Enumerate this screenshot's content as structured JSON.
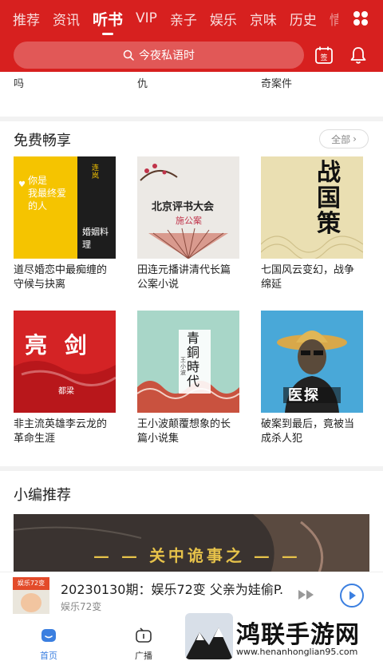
{
  "header": {
    "tabs": [
      "推荐",
      "资讯",
      "听书",
      "VIP",
      "亲子",
      "娱乐",
      "京味",
      "历史",
      "情"
    ],
    "active_tab": "听书",
    "search_placeholder": "今夜私语时",
    "calendar_label": "签"
  },
  "top_strip": {
    "items": [
      "吗",
      "仇",
      "奇案件"
    ]
  },
  "free_section": {
    "title": "免费畅享",
    "more_label": "全部",
    "books": [
      {
        "title": "道尽婚恋中最痴缠的守候与抉离",
        "cover_text": [
          "你是",
          "我最终爱",
          "的人",
          "婚姻料理"
        ],
        "cover_author": "连岚"
      },
      {
        "title": "田连元播讲清代长篇公案小说",
        "cover_text": [
          "北京评书大会",
          "施公案"
        ]
      },
      {
        "title": "七国风云变幻，战争绵延",
        "cover_text": [
          "战",
          "国",
          "策"
        ]
      },
      {
        "title": "非主流英雄李云龙的革命生涯",
        "cover_text": [
          "亮 剑",
          "都梁"
        ]
      },
      {
        "title": "王小波颠覆想象的长篇小说集",
        "cover_text": [
          "青",
          "銅",
          "時",
          "代"
        ],
        "cover_author": "王小波"
      },
      {
        "title": "破案到最后，竟被当成杀人犯",
        "cover_text": [
          "医探"
        ]
      }
    ]
  },
  "editor_section": {
    "title": "小编推荐",
    "banner_text": "关中诡事之"
  },
  "player": {
    "title": "20230130期：娱乐72变 父亲为娃偷P...",
    "subtitle": "娱乐72变",
    "cover_text": "娱乐72变"
  },
  "nav": {
    "items": [
      "首页",
      "广播"
    ]
  },
  "watermark": {
    "text": "鸿联手游网",
    "url": "www.henanhonglian95.com"
  },
  "colors": {
    "brand_red": "#d7201f",
    "accent_blue": "#3b7fe0"
  }
}
